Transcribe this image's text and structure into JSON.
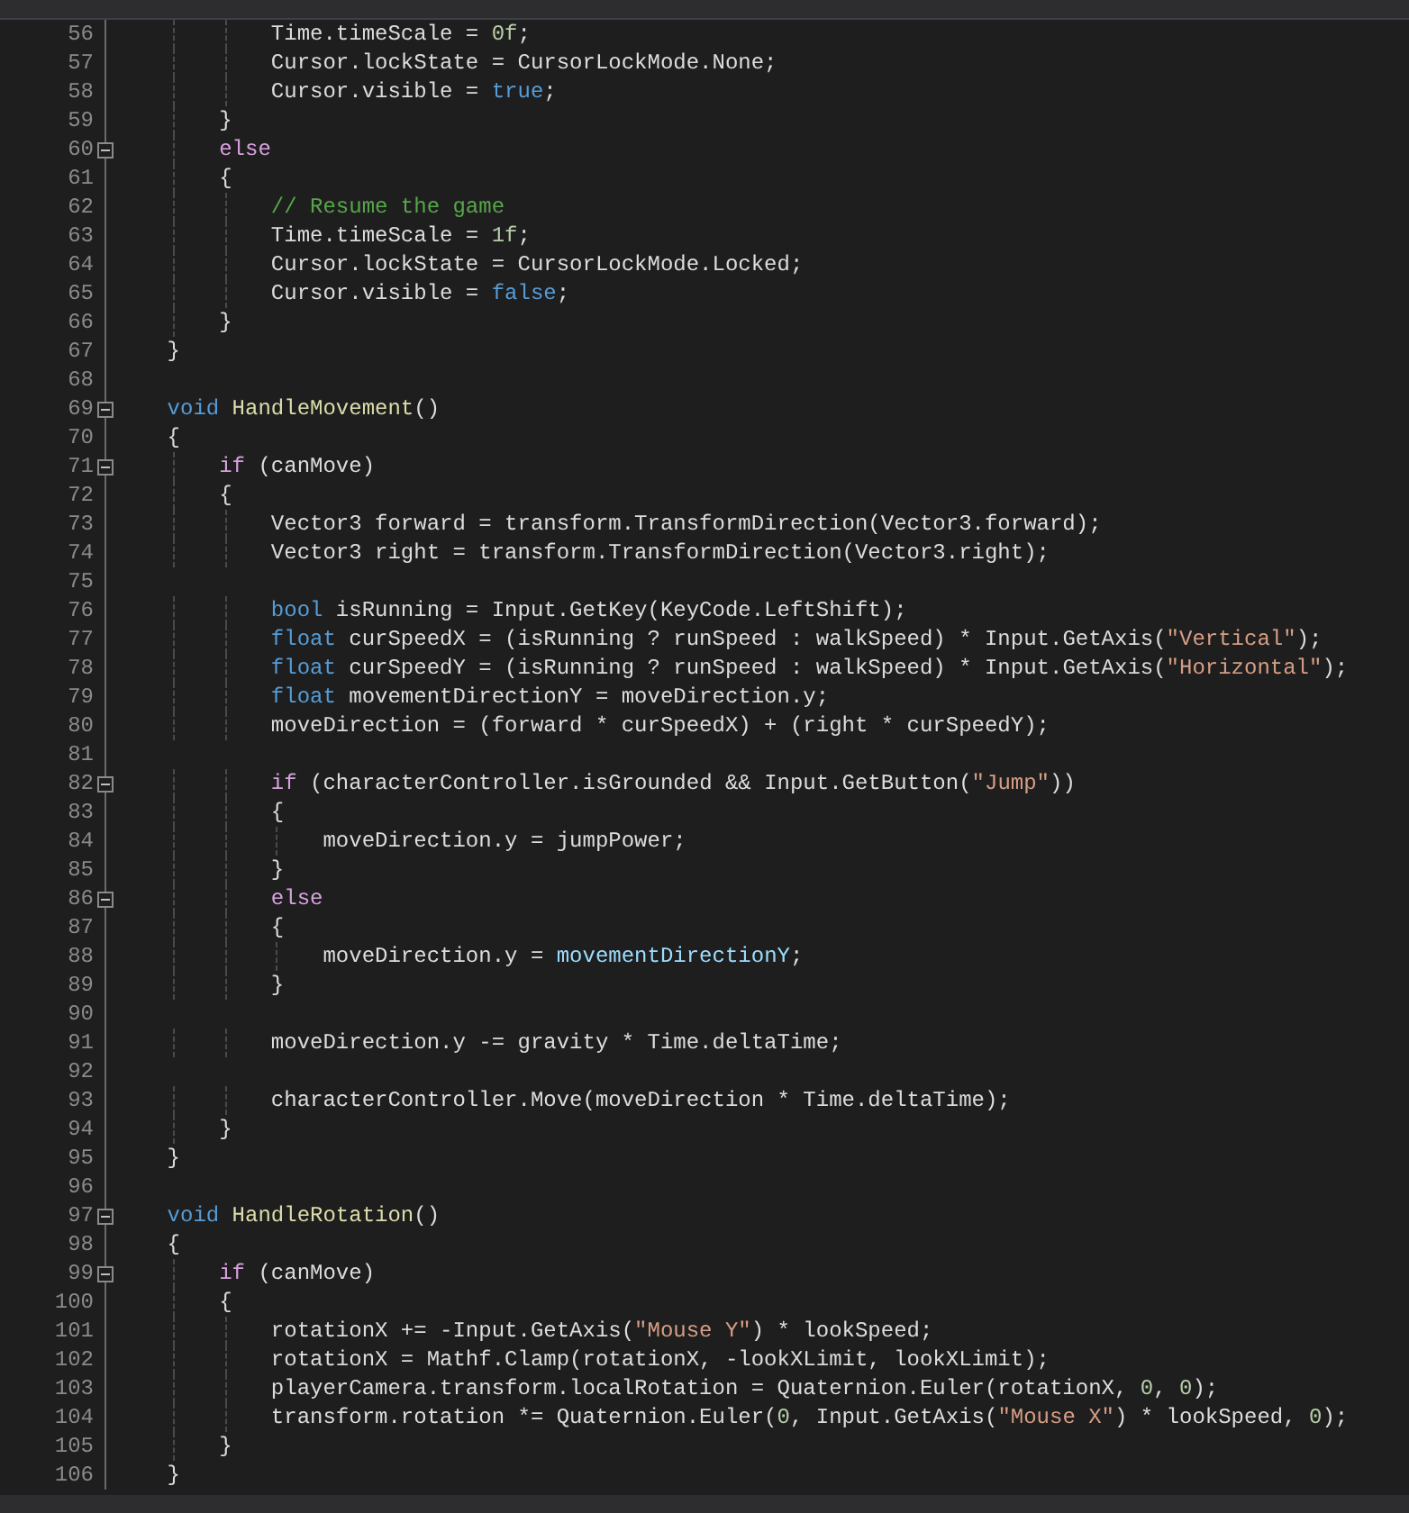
{
  "lines": [
    {
      "number": "56",
      "tokens": [
        {
          "kind": "plain",
          "text": "            Time.timeScale = "
        },
        {
          "kind": "number",
          "text": "0f"
        },
        {
          "kind": "plain",
          "text": ";"
        }
      ]
    },
    {
      "number": "57",
      "tokens": [
        {
          "kind": "plain",
          "text": "            Cursor.lockState = CursorLockMode.None;"
        }
      ]
    },
    {
      "number": "58",
      "tokens": [
        {
          "kind": "plain",
          "text": "            Cursor.visible = "
        },
        {
          "kind": "keyword",
          "text": "true"
        },
        {
          "kind": "plain",
          "text": ";"
        }
      ]
    },
    {
      "number": "59",
      "tokens": [
        {
          "kind": "plain",
          "text": "        }"
        }
      ]
    },
    {
      "number": "60",
      "foldable": true,
      "tokens": [
        {
          "kind": "control",
          "text": "        else"
        }
      ]
    },
    {
      "number": "61",
      "tokens": [
        {
          "kind": "plain",
          "text": "        {"
        }
      ]
    },
    {
      "number": "62",
      "tokens": [
        {
          "kind": "comment",
          "text": "            // Resume the game"
        }
      ]
    },
    {
      "number": "63",
      "tokens": [
        {
          "kind": "plain",
          "text": "            Time.timeScale = "
        },
        {
          "kind": "number",
          "text": "1f"
        },
        {
          "kind": "plain",
          "text": ";"
        }
      ]
    },
    {
      "number": "64",
      "tokens": [
        {
          "kind": "plain",
          "text": "            Cursor.lockState = CursorLockMode.Locked;"
        }
      ]
    },
    {
      "number": "65",
      "tokens": [
        {
          "kind": "plain",
          "text": "            Cursor.visible = "
        },
        {
          "kind": "keyword",
          "text": "false"
        },
        {
          "kind": "plain",
          "text": ";"
        }
      ]
    },
    {
      "number": "66",
      "tokens": [
        {
          "kind": "plain",
          "text": "        }"
        }
      ]
    },
    {
      "number": "67",
      "tokens": [
        {
          "kind": "plain",
          "text": "    }"
        }
      ]
    },
    {
      "number": "68"
    },
    {
      "number": "69",
      "foldable": true,
      "tokens": [
        {
          "kind": "keyword",
          "text": "    void"
        },
        {
          "kind": "function",
          "text": " HandleMovement"
        },
        {
          "kind": "plain",
          "text": "()"
        }
      ]
    },
    {
      "number": "70",
      "tokens": [
        {
          "kind": "plain",
          "text": "    {"
        }
      ]
    },
    {
      "number": "71",
      "foldable": true,
      "tokens": [
        {
          "kind": "control",
          "text": "        if"
        },
        {
          "kind": "plain",
          "text": " (canMove)"
        }
      ]
    },
    {
      "number": "72",
      "tokens": [
        {
          "kind": "plain",
          "text": "        {"
        }
      ]
    },
    {
      "number": "73",
      "tokens": [
        {
          "kind": "plain",
          "text": "            Vector3 forward = transform.TransformDirection(Vector3.forward);"
        }
      ]
    },
    {
      "number": "74",
      "tokens": [
        {
          "kind": "plain",
          "text": "            Vector3 right = transform.TransformDirection(Vector3.right);"
        }
      ]
    },
    {
      "number": "75"
    },
    {
      "number": "76",
      "tokens": [
        {
          "kind": "keyword",
          "text": "            bool"
        },
        {
          "kind": "plain",
          "text": " isRunning = Input.GetKey(KeyCode.LeftShift);"
        }
      ]
    },
    {
      "number": "77",
      "tokens": [
        {
          "kind": "keyword",
          "text": "            float"
        },
        {
          "kind": "plain",
          "text": " curSpeedX = (isRunning ? runSpeed : walkSpeed) * Input.GetAxis("
        },
        {
          "kind": "string",
          "text": "\"Vertical\""
        },
        {
          "kind": "plain",
          "text": ");"
        }
      ]
    },
    {
      "number": "78",
      "tokens": [
        {
          "kind": "keyword",
          "text": "            float"
        },
        {
          "kind": "plain",
          "text": " curSpeedY = (isRunning ? runSpeed : walkSpeed) * Input.GetAxis("
        },
        {
          "kind": "string",
          "text": "\"Horizontal\""
        },
        {
          "kind": "plain",
          "text": ");"
        }
      ]
    },
    {
      "number": "79",
      "tokens": [
        {
          "kind": "keyword",
          "text": "            float"
        },
        {
          "kind": "plain",
          "text": " movementDirectionY = moveDirection.y;"
        }
      ]
    },
    {
      "number": "80",
      "tokens": [
        {
          "kind": "plain",
          "text": "            moveDirection = (forward * curSpeedX) + (right * curSpeedY);"
        }
      ]
    },
    {
      "number": "81"
    },
    {
      "number": "82",
      "foldable": true,
      "tokens": [
        {
          "kind": "control",
          "text": "            if"
        },
        {
          "kind": "plain",
          "text": " (characterController.isGrounded && Input.GetButton("
        },
        {
          "kind": "string",
          "text": "\"Jump\""
        },
        {
          "kind": "plain",
          "text": "))"
        }
      ]
    },
    {
      "number": "83",
      "tokens": [
        {
          "kind": "plain",
          "text": "            {"
        }
      ]
    },
    {
      "number": "84",
      "tokens": [
        {
          "kind": "plain",
          "text": "                moveDirection.y = jumpPower;"
        }
      ]
    },
    {
      "number": "85",
      "tokens": [
        {
          "kind": "plain",
          "text": "            }"
        }
      ]
    },
    {
      "number": "86",
      "foldable": true,
      "tokens": [
        {
          "kind": "control",
          "text": "            else"
        }
      ]
    },
    {
      "number": "87",
      "tokens": [
        {
          "kind": "plain",
          "text": "            {"
        }
      ]
    },
    {
      "number": "88",
      "tokens": [
        {
          "kind": "plain",
          "text": "                moveDirection.y = "
        },
        {
          "kind": "variable",
          "text": "movementDirectionY"
        },
        {
          "kind": "plain",
          "text": ";"
        }
      ]
    },
    {
      "number": "89",
      "tokens": [
        {
          "kind": "plain",
          "text": "            }"
        }
      ]
    },
    {
      "number": "90"
    },
    {
      "number": "91",
      "tokens": [
        {
          "kind": "plain",
          "text": "            moveDirection.y -= gravity * Time.deltaTime;"
        }
      ]
    },
    {
      "number": "92"
    },
    {
      "number": "93",
      "tokens": [
        {
          "kind": "plain",
          "text": "            characterController.Move(moveDirection * Time.deltaTime);"
        }
      ]
    },
    {
      "number": "94",
      "tokens": [
        {
          "kind": "plain",
          "text": "        }"
        }
      ]
    },
    {
      "number": "95",
      "tokens": [
        {
          "kind": "plain",
          "text": "    }"
        }
      ]
    },
    {
      "number": "96"
    },
    {
      "number": "97",
      "foldable": true,
      "tokens": [
        {
          "kind": "keyword",
          "text": "    void"
        },
        {
          "kind": "function",
          "text": " HandleRotation"
        },
        {
          "kind": "plain",
          "text": "()"
        }
      ]
    },
    {
      "number": "98",
      "tokens": [
        {
          "kind": "plain",
          "text": "    {"
        }
      ]
    },
    {
      "number": "99",
      "foldable": true,
      "tokens": [
        {
          "kind": "control",
          "text": "        if"
        },
        {
          "kind": "plain",
          "text": " (canMove)"
        }
      ]
    },
    {
      "number": "100",
      "tokens": [
        {
          "kind": "plain",
          "text": "        {"
        }
      ]
    },
    {
      "number": "101",
      "tokens": [
        {
          "kind": "plain",
          "text": "            rotationX += -Input.GetAxis("
        },
        {
          "kind": "string",
          "text": "\"Mouse Y\""
        },
        {
          "kind": "plain",
          "text": ") * lookSpeed;"
        }
      ]
    },
    {
      "number": "102",
      "tokens": [
        {
          "kind": "plain",
          "text": "            rotationX = Mathf.Clamp(rotationX, -lookXLimit, lookXLimit);"
        }
      ]
    },
    {
      "number": "103",
      "tokens": [
        {
          "kind": "plain",
          "text": "            playerCamera.transform.localRotation = Quaternion.Euler(rotationX, "
        },
        {
          "kind": "number",
          "text": "0"
        },
        {
          "kind": "plain",
          "text": ", "
        },
        {
          "kind": "number",
          "text": "0"
        },
        {
          "kind": "plain",
          "text": ");"
        }
      ]
    },
    {
      "number": "104",
      "tokens": [
        {
          "kind": "plain",
          "text": "            transform.rotation *= Quaternion.Euler("
        },
        {
          "kind": "number",
          "text": "0"
        },
        {
          "kind": "plain",
          "text": ", Input.GetAxis("
        },
        {
          "kind": "string",
          "text": "\"Mouse X\""
        },
        {
          "kind": "plain",
          "text": ") * lookSpeed, "
        },
        {
          "kind": "number",
          "text": "0"
        },
        {
          "kind": "plain",
          "text": ");"
        }
      ]
    },
    {
      "number": "105",
      "tokens": [
        {
          "kind": "plain",
          "text": "        }"
        }
      ]
    },
    {
      "number": "106",
      "tokens": [
        {
          "kind": "plain",
          "text": "    }"
        }
      ]
    }
  ]
}
